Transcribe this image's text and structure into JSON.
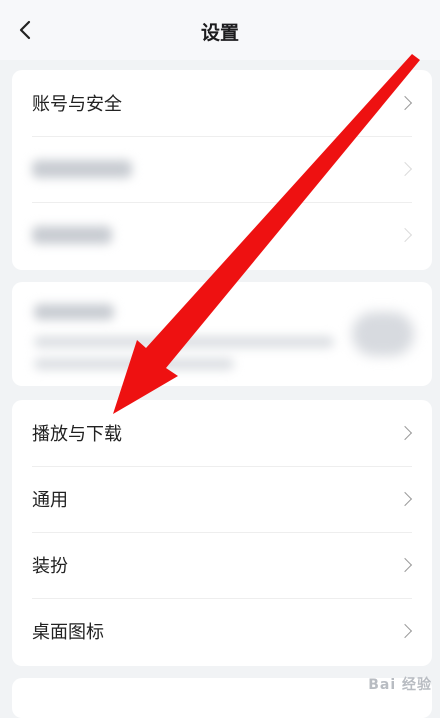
{
  "header": {
    "title": "设置"
  },
  "sections": {
    "account": {
      "label": "账号与安全"
    },
    "media": [
      {
        "label": "播放与下载"
      },
      {
        "label": "通用"
      },
      {
        "label": "装扮"
      },
      {
        "label": "桌面图标"
      }
    ]
  },
  "colors": {
    "arrow": "#ee1111",
    "background": "#f1f3f5"
  },
  "icons": {
    "back": "chevron-left-icon",
    "row": "chevron-right-icon"
  }
}
